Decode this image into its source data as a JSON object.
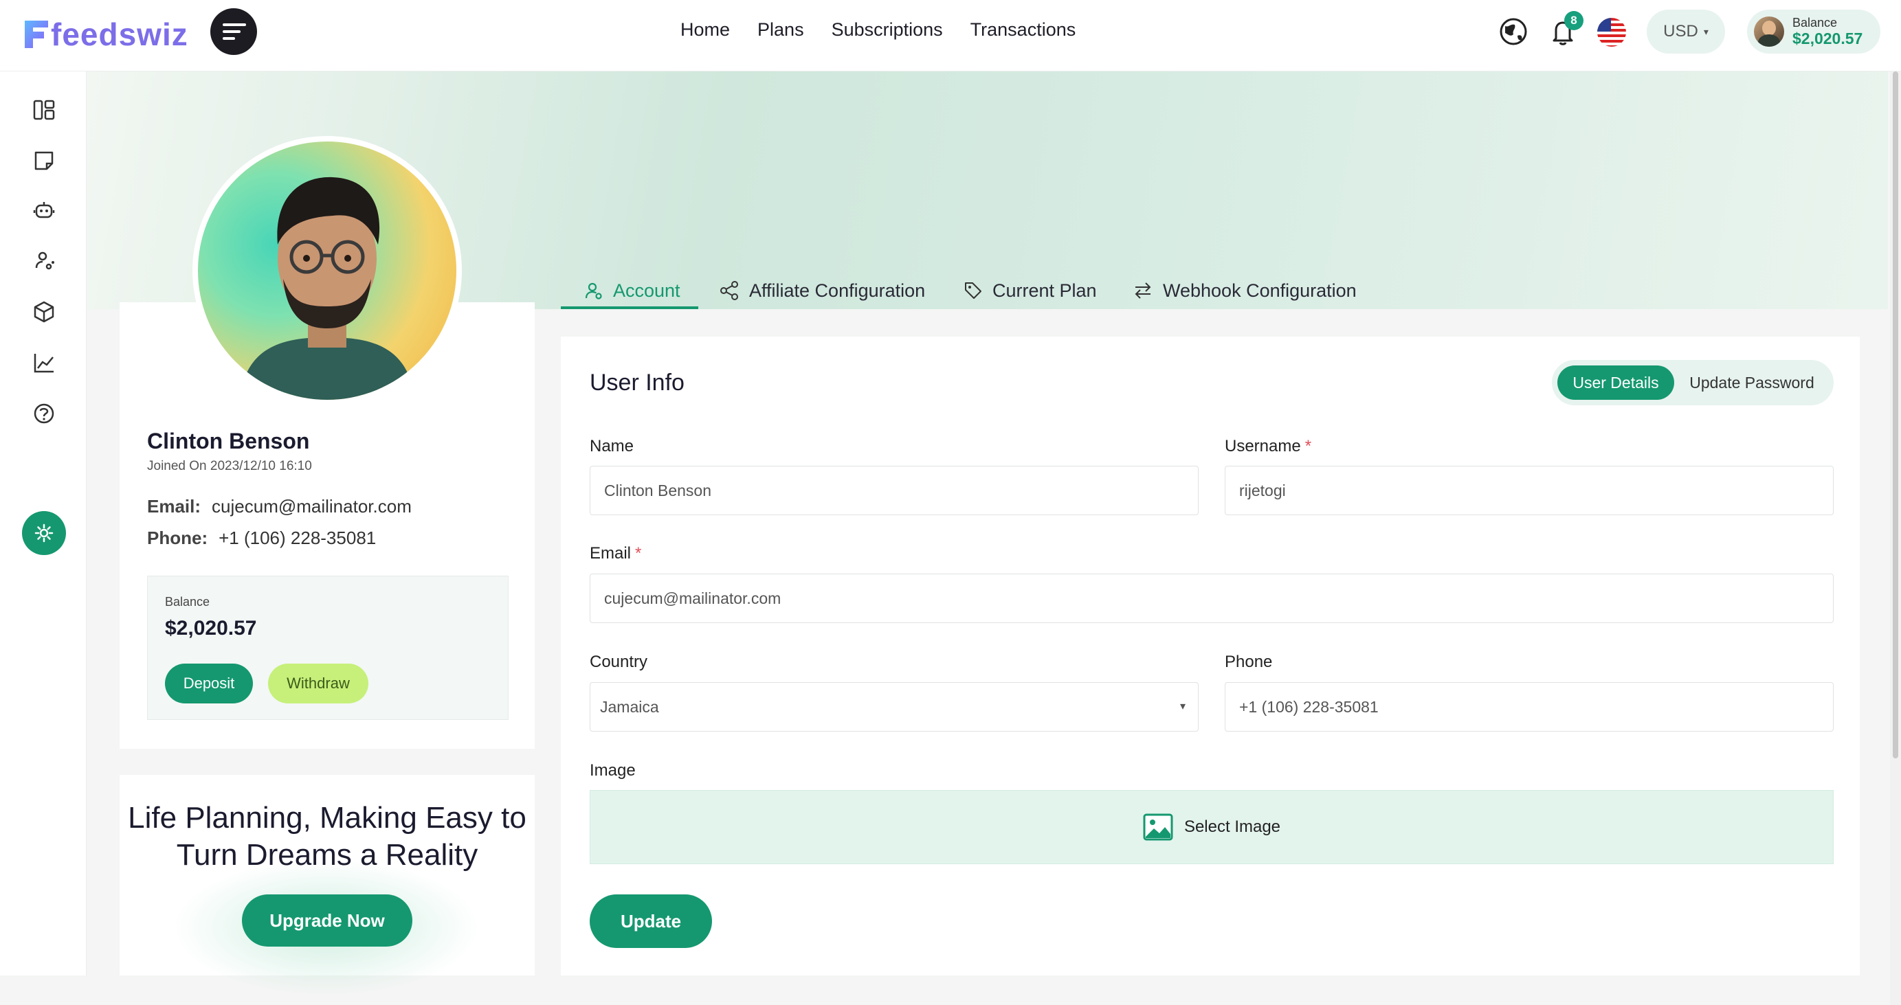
{
  "brand": {
    "name": "feedswiz",
    "accent": "#15986f",
    "logo_color": "#7c6ee8"
  },
  "header": {
    "nav": [
      "Home",
      "Plans",
      "Subscriptions",
      "Transactions"
    ],
    "notifications_count": "8",
    "currency": "USD",
    "balance_label": "Balance",
    "balance_value": "$2,020.57",
    "icons": [
      "menu-icon",
      "globe-icon",
      "bell-icon",
      "us-flag-icon",
      "chevron-down-icon"
    ]
  },
  "sidebar": {
    "icons": [
      "dashboard-icon",
      "notes-icon",
      "robot-icon",
      "user-network-icon",
      "box-icon",
      "chart-line-icon",
      "help-icon",
      "settings-icon"
    ],
    "active": "settings-icon"
  },
  "profile": {
    "name": "Clinton Benson",
    "joined": "Joined On 2023/12/10 16:10",
    "email_label": "Email:",
    "email": "cujecum@mailinator.com",
    "phone_label": "Phone:",
    "phone": "+1 (106) 228-35081",
    "balance_label": "Balance",
    "balance_value": "$2,020.57",
    "deposit_label": "Deposit",
    "withdraw_label": "Withdraw"
  },
  "promo": {
    "title": "Life Planning, Making Easy to Turn Dreams a Reality",
    "button_label": "Upgrade Now"
  },
  "tabs": [
    {
      "label": "Account",
      "icon": "user-icon",
      "active": true
    },
    {
      "label": "Affiliate Configuration",
      "icon": "share-icon",
      "active": false
    },
    {
      "label": "Current Plan",
      "icon": "tag-icon",
      "active": false
    },
    {
      "label": "Webhook Configuration",
      "icon": "swap-icon",
      "active": false
    }
  ],
  "user_info": {
    "title": "User Info",
    "segments": {
      "active": "User Details",
      "other": "Update Password"
    },
    "fields": {
      "name": {
        "label": "Name",
        "value": "Clinton Benson",
        "required": false
      },
      "username": {
        "label": "Username",
        "value": "rijetogi",
        "required": true
      },
      "email": {
        "label": "Email",
        "value": "cujecum@mailinator.com",
        "required": true
      },
      "country": {
        "label": "Country",
        "value": "Jamaica",
        "required": false
      },
      "phone": {
        "label": "Phone",
        "value": "+1 (106) 228-35081",
        "required": false
      },
      "image": {
        "label": "Image",
        "button": "Select Image"
      }
    },
    "required_mark": "*",
    "update_label": "Update"
  }
}
